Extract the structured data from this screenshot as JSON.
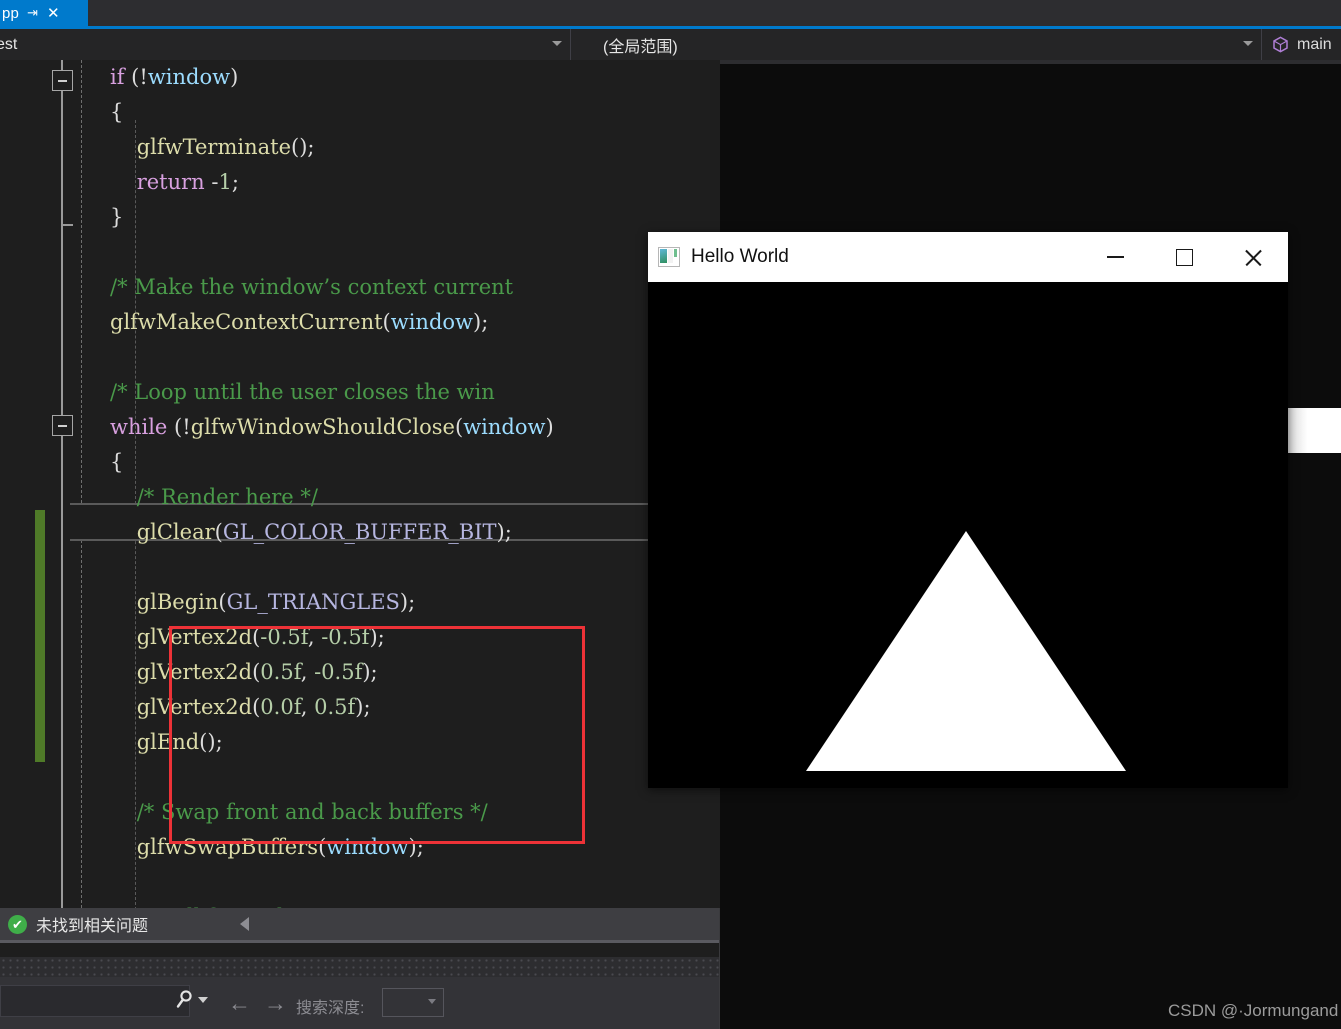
{
  "ide": {
    "tab": {
      "label": "pp",
      "pin_icon": "pin-icon",
      "close_icon": "close-icon"
    },
    "navbar": {
      "scope_value": "est",
      "member_value": "(全局范围)",
      "symbol_value": "main",
      "symbol_icon": "method-cube-icon",
      "dropdown_icon": "chevron-down-icon"
    },
    "editor": {
      "font_size": 21,
      "lines": [
        {
          "indent": 0,
          "tokens": [
            {
              "t": "if ",
              "c": "kw"
            },
            {
              "t": "(!",
              "c": "pn"
            },
            {
              "t": "window",
              "c": "id"
            },
            {
              "t": ")",
              "c": "pn"
            }
          ]
        },
        {
          "indent": 0,
          "tokens": [
            {
              "t": "{",
              "c": "pn"
            }
          ]
        },
        {
          "indent": 0,
          "tokens": [
            {
              "t": "    ",
              "c": "pn"
            },
            {
              "t": "glfwTerminate",
              "c": "fn"
            },
            {
              "t": "()",
              "c": "pn"
            },
            {
              "t": ";",
              "c": "pn"
            }
          ]
        },
        {
          "indent": 0,
          "tokens": [
            {
              "t": "    ",
              "c": "pn"
            },
            {
              "t": "return",
              "c": "kw"
            },
            {
              "t": " -",
              "c": "pn"
            },
            {
              "t": "1",
              "c": "num"
            },
            {
              "t": ";",
              "c": "pn"
            }
          ]
        },
        {
          "indent": 0,
          "tokens": [
            {
              "t": "}",
              "c": "pn"
            }
          ]
        },
        {
          "indent": 0,
          "tokens": []
        },
        {
          "indent": 0,
          "tokens": [
            {
              "t": "/* Make the window’s context current",
              "c": "cm"
            }
          ]
        },
        {
          "indent": 0,
          "tokens": [
            {
              "t": "glfwMakeContextCurrent",
              "c": "fn"
            },
            {
              "t": "(",
              "c": "pn"
            },
            {
              "t": "window",
              "c": "id"
            },
            {
              "t": ")",
              "c": "pn"
            },
            {
              "t": ";",
              "c": "pn"
            }
          ]
        },
        {
          "indent": 0,
          "tokens": []
        },
        {
          "indent": 0,
          "tokens": [
            {
              "t": "/* Loop until the user closes the win",
              "c": "cm"
            }
          ]
        },
        {
          "indent": 0,
          "tokens": [
            {
              "t": "while",
              "c": "kw"
            },
            {
              "t": " (!",
              "c": "pn"
            },
            {
              "t": "glfwWindowShouldClose",
              "c": "fn"
            },
            {
              "t": "(",
              "c": "pn"
            },
            {
              "t": "window",
              "c": "id"
            },
            {
              "t": ")",
              "c": "pn"
            }
          ]
        },
        {
          "indent": 0,
          "tokens": [
            {
              "t": "{",
              "c": "pn"
            }
          ]
        },
        {
          "indent": 0,
          "tokens": [
            {
              "t": "    ",
              "c": "pn"
            },
            {
              "t": "/* Render here */",
              "c": "cm"
            }
          ]
        },
        {
          "indent": 0,
          "tokens": [
            {
              "t": "    ",
              "c": "pn"
            },
            {
              "t": "glClear",
              "c": "fn"
            },
            {
              "t": "(",
              "c": "pn"
            },
            {
              "t": "GL_COLOR_BUFFER_BIT",
              "c": "mac"
            },
            {
              "t": ")",
              "c": "pn"
            },
            {
              "t": ";",
              "c": "pn"
            }
          ]
        },
        {
          "indent": 0,
          "tokens": []
        },
        {
          "indent": 0,
          "tokens": [
            {
              "t": "    ",
              "c": "pn"
            },
            {
              "t": "glBegin",
              "c": "fn"
            },
            {
              "t": "(",
              "c": "pn"
            },
            {
              "t": "GL_TRIANGLES",
              "c": "mac"
            },
            {
              "t": ")",
              "c": "pn"
            },
            {
              "t": ";",
              "c": "pn"
            }
          ]
        },
        {
          "indent": 0,
          "tokens": [
            {
              "t": "    ",
              "c": "pn"
            },
            {
              "t": "glVertex2d",
              "c": "fn"
            },
            {
              "t": "(",
              "c": "pn"
            },
            {
              "t": "-0.5f",
              "c": "num"
            },
            {
              "t": ", ",
              "c": "pn"
            },
            {
              "t": "-0.5f",
              "c": "num"
            },
            {
              "t": ")",
              "c": "pn"
            },
            {
              "t": ";",
              "c": "pn"
            }
          ]
        },
        {
          "indent": 0,
          "tokens": [
            {
              "t": "    ",
              "c": "pn"
            },
            {
              "t": "glVertex2d",
              "c": "fn"
            },
            {
              "t": "(",
              "c": "pn"
            },
            {
              "t": "0.5f",
              "c": "num"
            },
            {
              "t": ", ",
              "c": "pn"
            },
            {
              "t": "-0.5f",
              "c": "num"
            },
            {
              "t": ")",
              "c": "pn"
            },
            {
              "t": ";",
              "c": "pn"
            }
          ]
        },
        {
          "indent": 0,
          "tokens": [
            {
              "t": "    ",
              "c": "pn"
            },
            {
              "t": "glVertex2d",
              "c": "fn"
            },
            {
              "t": "(",
              "c": "pn"
            },
            {
              "t": "0.0f",
              "c": "num"
            },
            {
              "t": ", ",
              "c": "pn"
            },
            {
              "t": "0.5f",
              "c": "num"
            },
            {
              "t": ")",
              "c": "pn"
            },
            {
              "t": ";",
              "c": "pn"
            }
          ]
        },
        {
          "indent": 0,
          "tokens": [
            {
              "t": "    ",
              "c": "pn"
            },
            {
              "t": "glEnd",
              "c": "fn"
            },
            {
              "t": "()",
              "c": "pn"
            },
            {
              "t": ";",
              "c": "pn"
            }
          ]
        },
        {
          "indent": 0,
          "tokens": []
        },
        {
          "indent": 0,
          "tokens": [
            {
              "t": "    ",
              "c": "pn"
            },
            {
              "t": "/* Swap front and back buffers */",
              "c": "cm"
            }
          ]
        },
        {
          "indent": 0,
          "tokens": [
            {
              "t": "    ",
              "c": "pn"
            },
            {
              "t": "glfwSwapBuffers",
              "c": "fn"
            },
            {
              "t": "(",
              "c": "pn"
            },
            {
              "t": "window",
              "c": "id"
            },
            {
              "t": ")",
              "c": "pn"
            },
            {
              "t": ";",
              "c": "pn"
            }
          ]
        },
        {
          "indent": 0,
          "tokens": []
        },
        {
          "indent": 0,
          "tokens": [
            {
              "t": "    ",
              "c": "pn"
            },
            {
              "t": "/* Poll for and process events */",
              "c": "cm"
            }
          ]
        }
      ]
    },
    "errorlist": {
      "status_icon": "check-circle-icon",
      "message": "未找到相关问题",
      "collapse_icon": "triangle-left-icon"
    },
    "findbar": {
      "search_value": "",
      "search_placeholder": "",
      "search_icon": "magnifier-icon",
      "dropdown_icon": "chevron-down-icon",
      "back_icon": "arrow-left-icon",
      "forward_icon": "arrow-right-icon",
      "depth_label": "搜索深度:",
      "depth_value": "",
      "depth_dropdown_icon": "chevron-down-icon"
    }
  },
  "glfw_window": {
    "title": "Hello World",
    "app_icon": "app-window-icon",
    "minimize_icon": "minimize-icon",
    "maximize_icon": "maximize-icon",
    "close_icon": "close-icon",
    "canvas": {
      "background": "#000000",
      "shape": "triangle",
      "fill": "#ffffff",
      "vertices_ndc": [
        [
          -0.5,
          -0.5
        ],
        [
          0.5,
          -0.5
        ],
        [
          0.0,
          0.5
        ]
      ]
    }
  },
  "watermark": {
    "text": "CSDN @·Jormungand"
  },
  "colors": {
    "accent": "#007acc",
    "editor_bg": "#1e1e1e",
    "shell_bg": "#2d2d30",
    "annotation": "#ed3237",
    "change_bar": "#4f7a28",
    "ok_green": "#3fae49"
  }
}
